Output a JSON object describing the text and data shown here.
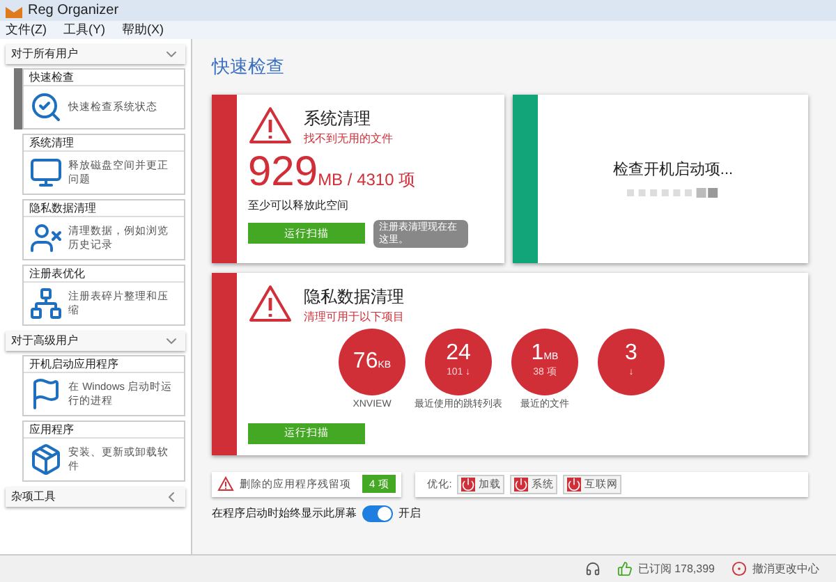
{
  "window": {
    "title": "Reg Organizer"
  },
  "menu": [
    "文件(Z)",
    "工具(Y)",
    "帮助(X)"
  ],
  "sidebar": {
    "groups": [
      {
        "title": "对于所有用户",
        "expanded": true,
        "items": [
          {
            "title": "快速检查",
            "description": "快速检查系统状态",
            "selected": true,
            "kind": "check"
          },
          {
            "title": "系统清理",
            "description": "释放磁盘空间并更正问题",
            "selected": false,
            "kind": "clean"
          },
          {
            "title": "隐私数据清理",
            "description": "清理数据，例如浏览历史记录",
            "selected": false,
            "kind": "privacy"
          },
          {
            "title": "注册表优化",
            "description": "注册表碎片整理和压缩",
            "selected": false,
            "kind": "registry"
          }
        ]
      },
      {
        "title": "对于高级用户",
        "expanded": true,
        "items": [
          {
            "title": "开机启动应用程序",
            "description": "在 Windows 启动时运行的进程",
            "selected": false,
            "kind": "startup"
          },
          {
            "title": "应用程序",
            "description": "安装、更新或卸载软件",
            "selected": false,
            "kind": "apps"
          }
        ]
      },
      {
        "title": "杂项工具",
        "expanded": false
      }
    ]
  },
  "page_title": "快速检查",
  "system_cleanup": {
    "title": "系统清理",
    "subtitle": "找不到无用的文件",
    "size": "929",
    "unit": "MB / 4310 项",
    "note": "至少可以释放此空间",
    "button": "运行扫描",
    "tooltip": "注册表清理现在在这里。"
  },
  "startup_check": {
    "text": "检查开机启动项..."
  },
  "privacy_cleanup": {
    "title": "隐私数据清理",
    "subtitle": "清理可用于以下项目",
    "button": "运行扫描",
    "bubbles": [
      {
        "value": "76",
        "unit": "KB",
        "label": "XNVIEW"
      },
      {
        "value": "24",
        "detail": "101 ↓",
        "label": "最近使用的跳转列表"
      },
      {
        "value": "1",
        "unit": "MB",
        "detail": "38 项",
        "label": "最近的文件"
      },
      {
        "value": "3",
        "detail": "↓"
      }
    ]
  },
  "leftovers": {
    "text": "删除的应用程序残留项",
    "count": "4 项"
  },
  "optimize": {
    "label": "优化:",
    "buttons": [
      "加载",
      "系统",
      "互联网"
    ]
  },
  "startup_toggle": {
    "label": "在程序启动时始终显示此屏幕",
    "on": true,
    "state_text": "开启"
  },
  "status_bar": {
    "subscribed": "已订阅 178,399",
    "undo_center": "撤消更改中心"
  }
}
